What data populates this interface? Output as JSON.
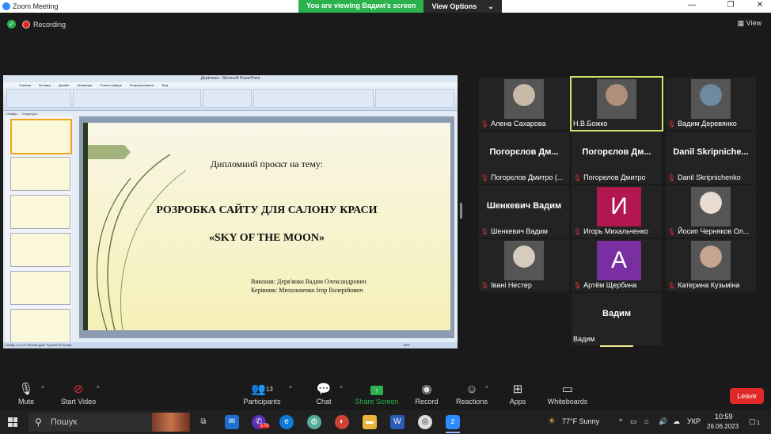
{
  "window": {
    "title": "Zoom Meeting",
    "controls": [
      "—",
      "❐",
      "✕"
    ]
  },
  "banner": {
    "viewing": "You are viewing Вадим's screen",
    "view_options": "View Options"
  },
  "recording": {
    "label": "Recording"
  },
  "view": {
    "label": "View"
  },
  "ppt": {
    "window_title": "Дерв'янко - Microsoft PowerPoint",
    "tabs": [
      "Главная",
      "Вставка",
      "Дизайн",
      "Анимация",
      "Показ слайдов",
      "Рецензирование",
      "Вид"
    ],
    "panel_tabs": [
      "Слайды",
      "Структура"
    ],
    "status": "Слайд 1 из 16   \"Легкий дым\"   Русский (Россия)",
    "zoom": "68%"
  },
  "slide": {
    "heading": "Дипломний проєкт на тему:",
    "title_line1": "РОЗРОБКА САЙТУ ДЛЯ САЛОНУ КРАСИ",
    "title_line2": "«SKY OF THE MOON»",
    "author": "Виконав: Дерв'янко Вадим Олександрович",
    "supervisor": "Керівник: Михальченко Ігор Валерійович"
  },
  "participants": [
    {
      "label": "Алена Сахарова",
      "type": "photo",
      "photo_color": "#c9b9a8",
      "muted": true
    },
    {
      "label": "Н.В.Божко",
      "type": "photo",
      "photo_color": "#b08f7a",
      "muted": false,
      "active": true
    },
    {
      "label": "Вадим Деревянко",
      "type": "photo",
      "photo_color": "#6d8aa0",
      "muted": true
    },
    {
      "big": "Погорєлов Дм...",
      "label": "Погорєлов Дмитро (...",
      "type": "name",
      "muted": true
    },
    {
      "big": "Погорєлов Дм...",
      "label": "Погорелов Дмитро",
      "type": "name",
      "muted": true
    },
    {
      "big": "Danil Skripniche...",
      "label": "Danil Skripnichenko",
      "type": "name",
      "muted": true
    },
    {
      "big": "Шенкевич Вадим",
      "label": "Шенкевич Вадим",
      "type": "name",
      "muted": true
    },
    {
      "label": "Игорь Михальченко",
      "type": "initial",
      "initial": "И",
      "initial_color": "#b3174f",
      "muted": true
    },
    {
      "label": "Йосип Черняков Ол...",
      "type": "photo",
      "photo_color": "#e8dcd2",
      "muted": true
    },
    {
      "label": "Івані Нестер",
      "type": "photo",
      "photo_color": "#d6cbbd",
      "muted": true
    },
    {
      "label": "Артём Щербина",
      "type": "initial",
      "initial": "А",
      "initial_color": "#7a2fa0",
      "muted": true
    },
    {
      "label": "Катерина Кузьміна",
      "type": "photo",
      "photo_color": "#c7a48f",
      "muted": true
    },
    {
      "big": "Вадим",
      "label": "Вадим",
      "type": "name",
      "muted": false,
      "speaking": true
    }
  ],
  "toolbar": {
    "mute": "Mute",
    "start_video": "Start Video",
    "participants": "Participants",
    "participants_count": "13",
    "chat": "Chat",
    "share_screen": "Share Screen",
    "record": "Record",
    "reactions": "Reactions",
    "apps": "Apps",
    "whiteboards": "Whiteboards",
    "leave": "Leave"
  },
  "taskbar": {
    "search_placeholder": "Пошук",
    "badge": "170",
    "weather": "77°F  Sunny",
    "lang": "УКР",
    "time": "10:59",
    "date": "26.06.2023",
    "notifications": "1"
  },
  "colors": {
    "green": "#2bb24c",
    "active_border": "#c9e86a",
    "leave": "#e02828",
    "share_green": "#2bb24c"
  }
}
